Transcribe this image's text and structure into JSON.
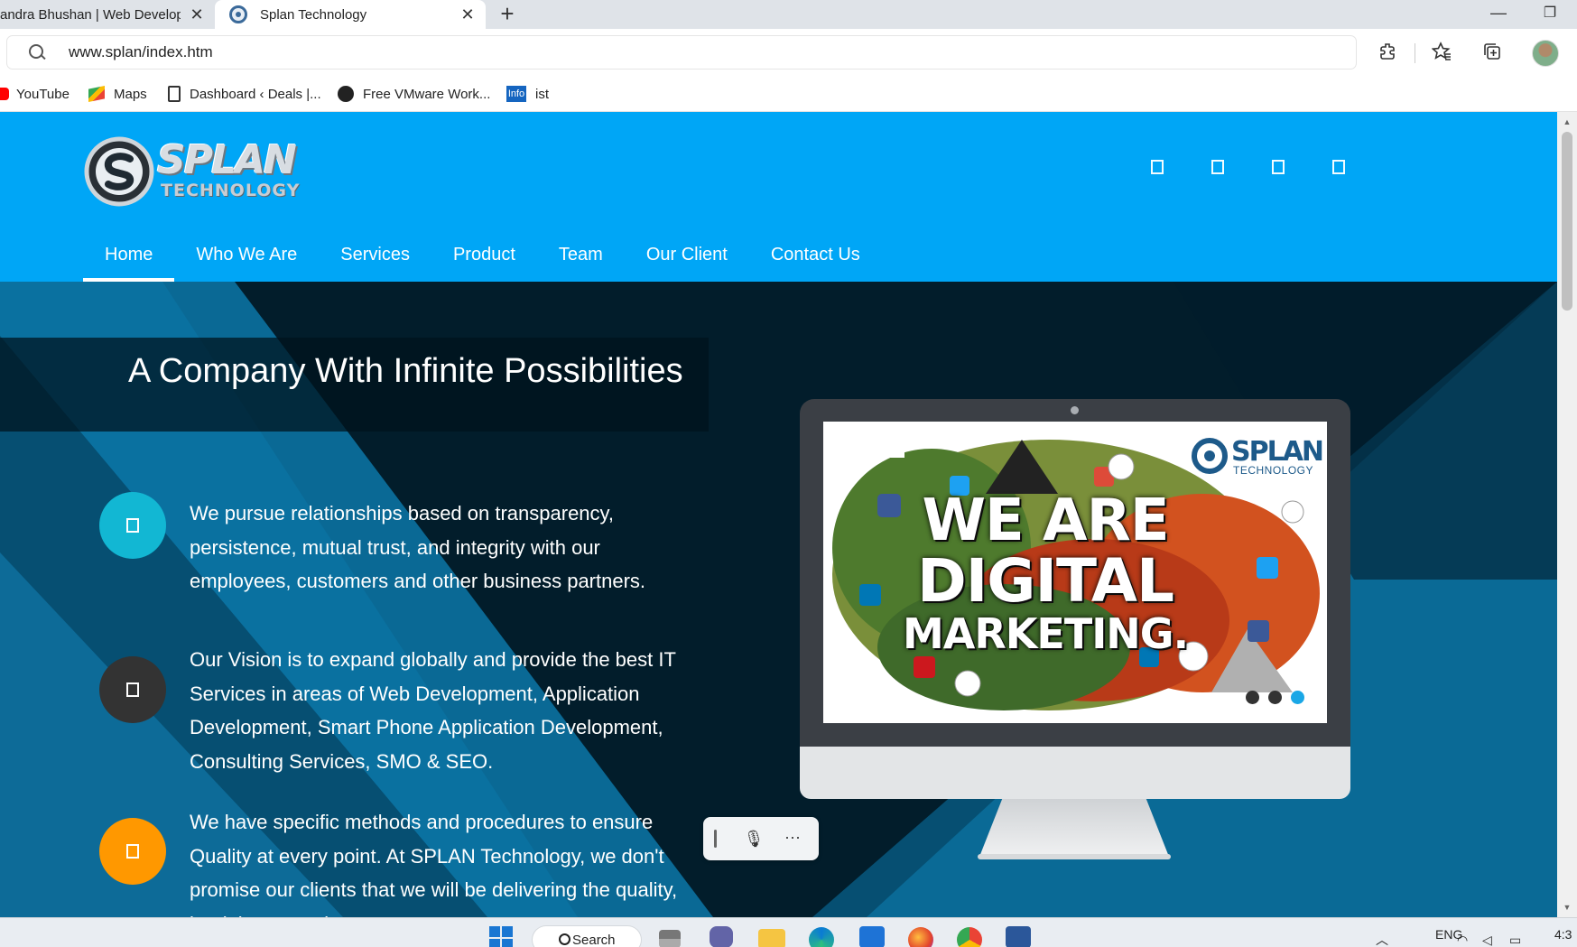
{
  "browser": {
    "tabs": [
      {
        "title": "andra Bhushan | Web Develop",
        "close_symbol": "✕"
      },
      {
        "title": "Splan Technology",
        "close_symbol": "✕"
      }
    ],
    "new_tab_symbol": "+",
    "window_controls": {
      "minimize": "—",
      "maximize": "❐"
    },
    "url": "www.splan/index.htm",
    "toolbar_icons": [
      "extensions-icon",
      "favorites-icon",
      "collections-icon",
      "profile-avatar"
    ],
    "bookmarks": [
      {
        "label": "YouTube",
        "icon": "youtube-icon"
      },
      {
        "label": "Maps",
        "icon": "maps-icon"
      },
      {
        "label": "Dashboard ‹ Deals |...",
        "icon": "document-icon"
      },
      {
        "label": "Free VMware Work...",
        "icon": "github-icon"
      },
      {
        "label": "ist",
        "icon": "info-icon",
        "icon_text": "Info"
      }
    ]
  },
  "site": {
    "brand_colors": {
      "header": "#00a6f6",
      "hero_dark": "#021d2b",
      "hero_mid": "#0a6a96"
    },
    "logo": {
      "text": "SPLAN",
      "subtext": "TECHNOLOGY"
    },
    "social_icons": [
      "social-icon-1",
      "social-icon-2",
      "social-icon-3",
      "social-icon-4"
    ],
    "nav": [
      {
        "label": "Home",
        "active": true
      },
      {
        "label": "Who We Are"
      },
      {
        "label": "Services"
      },
      {
        "label": "Product"
      },
      {
        "label": "Team"
      },
      {
        "label": "Our Client"
      },
      {
        "label": "Contact Us"
      }
    ],
    "hero": {
      "tagline_prefix": "A Company With ",
      "tagline_highlight": "Infinite",
      "tagline_suffix": " Possibilities",
      "features": [
        {
          "color": "#12b7d3",
          "text": "We pursue relationships based on transparency, persistence, mutual trust, and integrity with our employees, customers and other business partners."
        },
        {
          "color": "#333333",
          "text": "Our Vision is to expand globally and provide the best IT Services in areas of Web Development, Application Development, Smart Phone Application Development, Consulting Services, SMO & SEO."
        },
        {
          "color": "#ff9800",
          "text": "We have specific methods and procedures to ensure Quality at every point. At SPLAN Technology, we don't promise our clients that we will be delivering the quality, but it is assured."
        }
      ],
      "slider": {
        "headline_1": "WE ARE",
        "headline_2": "DIGITAL",
        "headline_3": "MARKETING.",
        "logo_text": "SPLAN",
        "logo_subtext": "TECHNOLOGY",
        "dots": 3,
        "active_dot": 3
      }
    }
  },
  "voice_typing": {
    "mic_icon": "🎙",
    "more_label": "···"
  },
  "taskbar": {
    "search_label": "Search",
    "language": "ENG",
    "clock": "4:3",
    "apps": [
      "start-icon",
      "task-view-icon",
      "teams-icon",
      "file-explorer-icon",
      "edge-icon",
      "store-icon",
      "firefox-icon",
      "chrome-icon",
      "word-icon"
    ]
  }
}
